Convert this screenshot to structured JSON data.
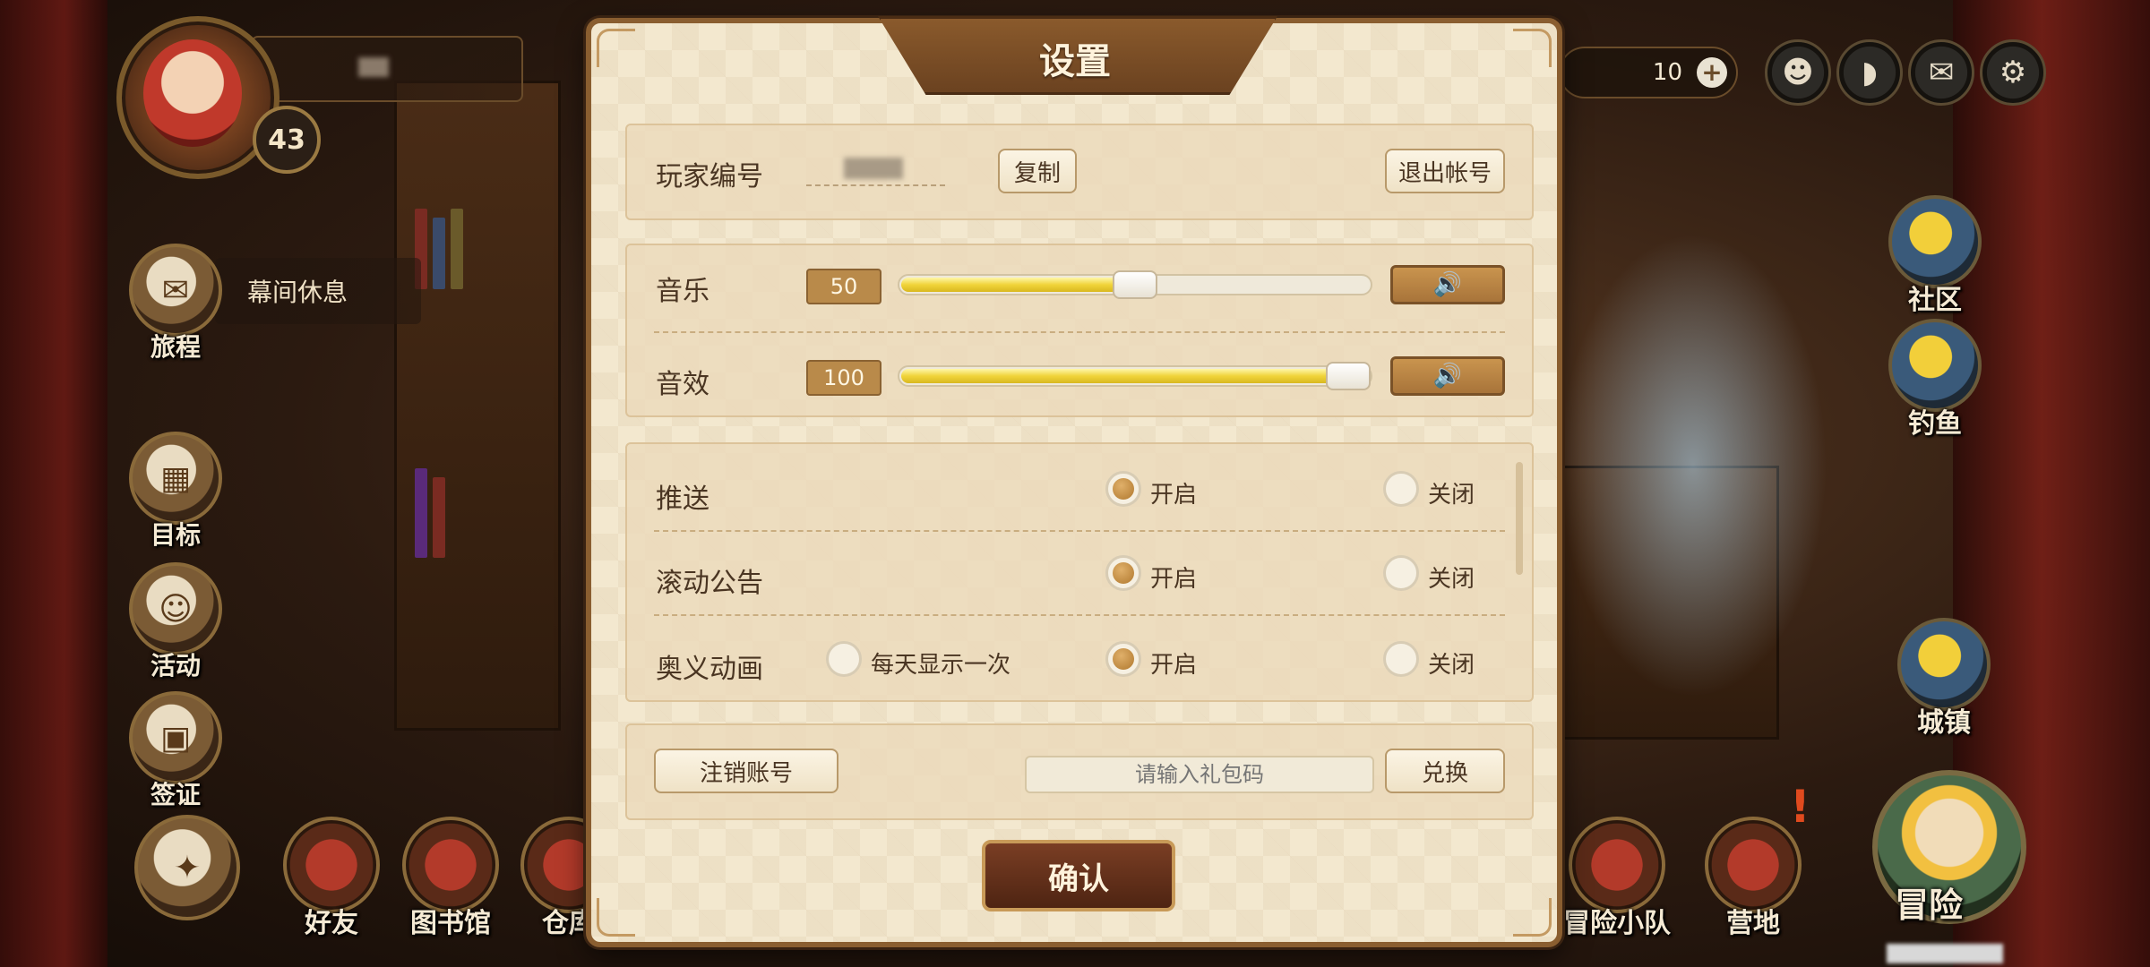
{
  "hud": {
    "level": "43",
    "side_menu": [
      {
        "label": "旅程",
        "icon": "scroll-icon"
      },
      {
        "label": "目标",
        "icon": "target-board-icon"
      },
      {
        "label": "活动",
        "icon": "event-icon"
      },
      {
        "label": "签证",
        "icon": "visa-icon"
      }
    ],
    "journey_note": "幕间休息",
    "bottom_menu": [
      {
        "label": "好友"
      },
      {
        "label": "图书馆"
      },
      {
        "label": "仓库"
      }
    ],
    "currency_value": "10",
    "right_menu": [
      {
        "label": "社区"
      },
      {
        "label": "钓鱼"
      },
      {
        "label": "城镇"
      }
    ],
    "bottom_right_menu": [
      {
        "label": "冒险小队"
      },
      {
        "label": "营地"
      }
    ],
    "adventure_label": "冒险"
  },
  "settings": {
    "title": "设置",
    "player_id_label": "玩家编号",
    "copy_button": "复制",
    "logout_button": "退出帐号",
    "music": {
      "label": "音乐",
      "value": "50",
      "level": 0.5
    },
    "sfx": {
      "label": "音效",
      "value": "100",
      "level": 1.0
    },
    "options": [
      {
        "label": "推送",
        "on_label": "开启",
        "off_label": "关闭",
        "selected": "on"
      },
      {
        "label": "滚动公告",
        "on_label": "开启",
        "off_label": "关闭",
        "selected": "on"
      },
      {
        "label": "奥义动画",
        "once_label": "每天显示一次",
        "on_label": "开启",
        "off_label": "关闭",
        "selected": "on"
      }
    ],
    "deactivate_button": "注销账号",
    "gift_placeholder": "请输入礼包码",
    "redeem_button": "兑换",
    "confirm_button": "确认"
  }
}
